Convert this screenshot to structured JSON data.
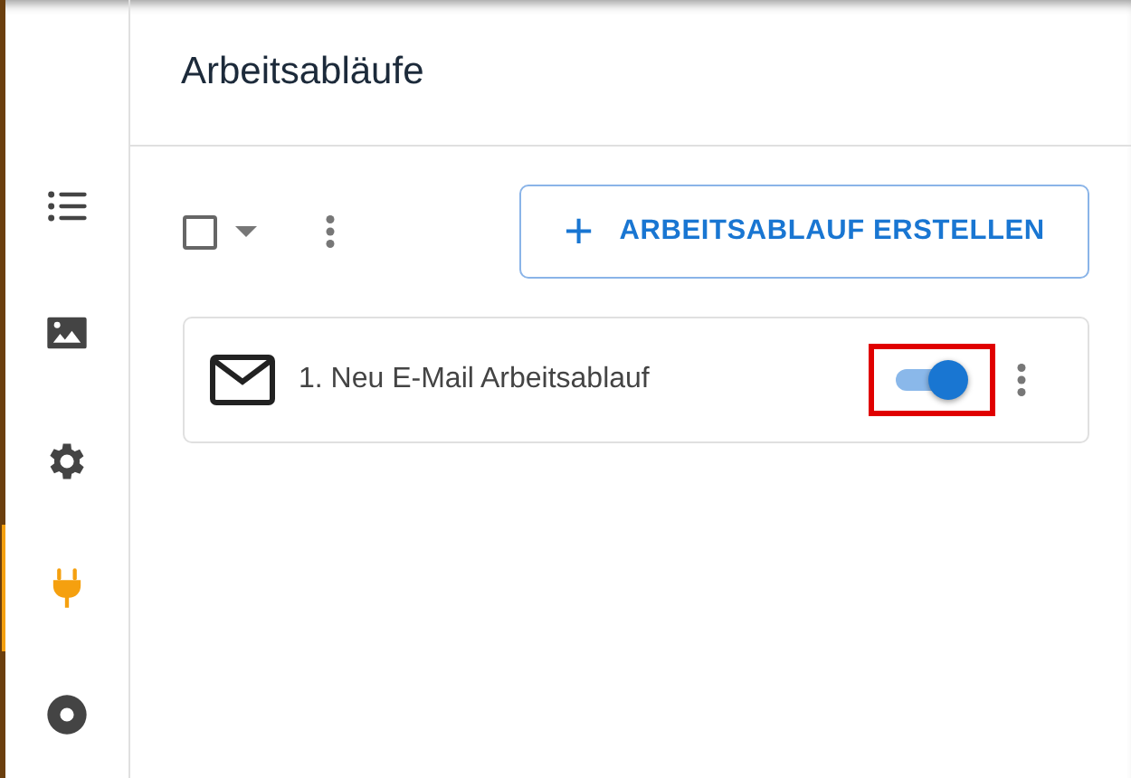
{
  "sidebar": {
    "items": [
      {
        "kind": "list",
        "selected": false
      },
      {
        "kind": "image",
        "selected": false
      },
      {
        "kind": "settings",
        "selected": false
      },
      {
        "kind": "plug",
        "selected": true
      },
      {
        "kind": "disc",
        "selected": false
      }
    ]
  },
  "header": {
    "title": "Arbeitsabläufe"
  },
  "toolbar": {
    "select_all": {
      "checked": false
    },
    "create_button": {
      "icon": "+",
      "label": "ARBEITSABLAUF ERSTELLEN"
    }
  },
  "workflows": [
    {
      "kind": "email",
      "name": "1. Neu E-Mail Arbeitsablauf",
      "on": true,
      "highlighted": true
    }
  ]
}
